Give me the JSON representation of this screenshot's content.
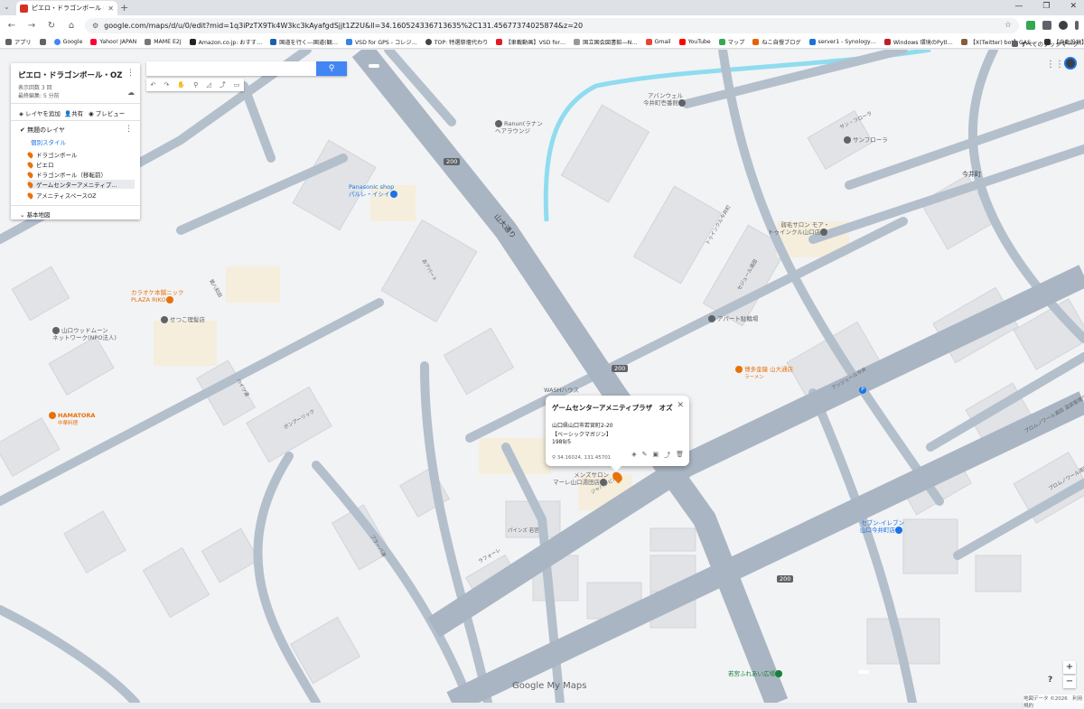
{
  "browser": {
    "tab_title": "ピエロ・ドラゴンボール・OZ（山口…",
    "url": "google.com/maps/d/u/0/edit?mid=1q3iPzTX9Tk4W3kc3kAyafgdSjjt1Z2U&ll=34.160524336713635%2C131.45677374025874&z=20",
    "bookmarks": [
      "アプリ",
      "Google",
      "Yahoo! JAPAN",
      "MAME E2J",
      "Amazon.co.jp: おすす…",
      "国道を行く---国道(観…",
      "VSD for GPS - コレジ…",
      "TOP: 特選祭壇代わり",
      "【車載動画】VSD for…",
      "国立国会図書館―N…",
      "Gmail",
      "YouTube",
      "マップ",
      "ねこ自慢ブログ",
      "server1 - Synology…",
      "Windows 環境のPytl…",
      "【X(Twitter) bot】GAS…",
      "【自動投稿】GASスプ…"
    ],
    "all_bookmarks": "すべてのブックマーク"
  },
  "panel": {
    "title": "ピエロ・ドラゴンボール・OZ（…",
    "views": "表示回数 3 回",
    "edited": "最終編集: 5 分前",
    "add_layer": "レイヤを追加",
    "share": "共有",
    "preview": "プレビュー",
    "layer_name": "無題のレイヤ",
    "style": "個別スタイル",
    "items": [
      "ドラゴンボール",
      "ピエロ",
      "ドラゴンボール（移転前）",
      "ゲームセンターアメニティプ…",
      "アメニティスペースOZ"
    ],
    "base_map": "基本地図"
  },
  "info": {
    "title": "ゲームセンターアメニティプラザ　オズ",
    "address": "山口県山口市若宮町2-20",
    "source": "【ベーシックマガジン】",
    "date": "1989/5",
    "coords": "34.16024, 131.45701"
  },
  "map_labels": {
    "r1": "200",
    "r2": "200",
    "r3": "200",
    "yamadai": "山大通り",
    "ranun": "Ranun(ラナン\nヘアラウンジ",
    "apan": "アバンウェル\n今井町壱番館",
    "sunflora_b": "サン・フローラ",
    "sunflora": "サンフローラ",
    "imaicho": "今井町",
    "panasonic": "Panasonic shop\nパルレ・イシイ",
    "salon_moa": "弱毛サロン モア・\nトゥインクル山口店",
    "karaoke": "カラオケ本舗ニック\nPLAZA RIKO",
    "setsuko": "せつこ理髪店",
    "yamaguchi_wood": "山口ウッドムーン\nネットワーク(NPO法人)",
    "apart": "アパート駐輪場",
    "hakata": "博多金龍 山大通店",
    "hakata_sub": "ラーメン",
    "washhouse": "WASHハウス",
    "hamatora": "HAMATORA",
    "hamatora_sub": "中華料理",
    "mens_salon": "メンズサロン\nマーレ山口湯田店",
    "seven": "セブン-イレブン\n山口今井町店",
    "wakamiya_park": "若宮ふれあい広場",
    "paines": "パインズ 若宮",
    "sun_jur": "アンジュール今井",
    "promenade": "プロムノワール湯田\n温泉管理グランデ",
    "promenade2": "プロムノワール湯田\nサイ子センター",
    "b_tryangle": "トゥインクル今井町",
    "b_sejour": "セジュール湯田",
    "b_heights": "ハイツ湯",
    "b_yagi": "第八和田",
    "b_apart": "あアパート",
    "b_bon": "ボンアーリック",
    "b_apartcity": "プラーバ湯",
    "b_jyapan": "ジャパンビル",
    "b_rafo": "ラフォーレ"
  },
  "logo": "Google My Maps",
  "copyright": "地図データ ©2026　利用規約",
  "icons": [
    "search-icon",
    "undo-icon",
    "redo-icon",
    "hand-icon",
    "marker-icon",
    "polygon-icon",
    "route-icon",
    "ruler-icon",
    "close-icon",
    "edit-icon",
    "camera-icon",
    "delete-icon",
    "apps-icon",
    "help-icon"
  ]
}
